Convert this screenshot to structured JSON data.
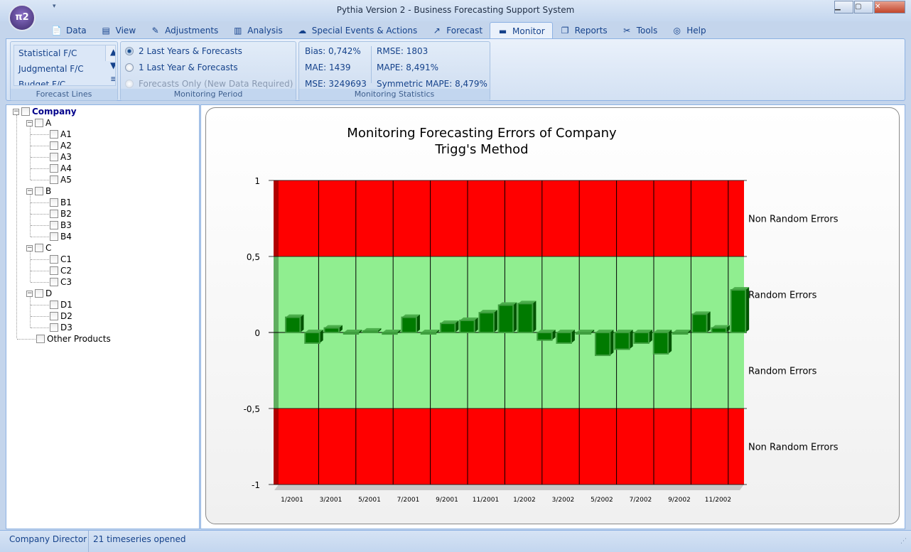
{
  "window": {
    "title": "Pythia Version 2 - Business Forecasting Support System",
    "orb_label": "π2"
  },
  "tabs": [
    {
      "label": "Data",
      "icon": "page-icon",
      "glyph": "📄"
    },
    {
      "label": "View",
      "icon": "view-icon",
      "glyph": "▤"
    },
    {
      "label": "Adjustments",
      "icon": "pencil-icon",
      "glyph": "✎"
    },
    {
      "label": "Analysis",
      "icon": "bar-chart-icon",
      "glyph": "▥"
    },
    {
      "label": "Special Events & Actions",
      "icon": "storm-icon",
      "glyph": "☁"
    },
    {
      "label": "Forecast",
      "icon": "line-chart-icon",
      "glyph": "↗"
    },
    {
      "label": "Monitor",
      "icon": "monitor-icon",
      "glyph": "▬",
      "active": true
    },
    {
      "label": "Reports",
      "icon": "reports-icon",
      "glyph": "❐"
    },
    {
      "label": "Tools",
      "icon": "tools-icon",
      "glyph": "✂"
    },
    {
      "label": "Help",
      "icon": "lifebuoy-icon",
      "glyph": "◎"
    }
  ],
  "ribbon": {
    "forecast_lines": {
      "label": "Forecast Lines",
      "items": [
        "Statistical F/C",
        "Judgmental F/C",
        "Budget F/C"
      ]
    },
    "monitoring_period": {
      "label": "Monitoring Period",
      "options": [
        {
          "label": "2 Last Years & Forecasts",
          "selected": true,
          "enabled": true
        },
        {
          "label": "1 Last Year & Forecasts",
          "selected": false,
          "enabled": true
        },
        {
          "label": "Forecasts Only (New Data Required)",
          "selected": false,
          "enabled": false
        }
      ]
    },
    "monitoring_statistics": {
      "label": "Monitoring Statistics",
      "bias": "Bias: 0,742%",
      "mae": "MAE: 1439",
      "mse": "MSE: 3249693",
      "rmse": "RMSE: 1803",
      "mape": "MAPE: 8,491%",
      "smape": "Symmetric MAPE: 8,479%"
    }
  },
  "tree": {
    "root": "Company",
    "groups": [
      {
        "name": "A",
        "children": [
          "A1",
          "A2",
          "A3",
          "A4",
          "A5"
        ]
      },
      {
        "name": "B",
        "children": [
          "B1",
          "B2",
          "B3",
          "B4"
        ]
      },
      {
        "name": "C",
        "children": [
          "C1",
          "C2",
          "C3"
        ]
      },
      {
        "name": "D",
        "children": [
          "D1",
          "D2",
          "D3"
        ]
      }
    ],
    "other": "Other Products"
  },
  "chart_data": {
    "type": "bar",
    "title": "Monitoring Forecasting Errors of Company",
    "subtitle": "Trigg's Method",
    "ylim": [
      -1,
      1
    ],
    "yticks": [
      "1",
      "0,5",
      "0",
      "-0,5",
      "-1"
    ],
    "ytick_values": [
      1,
      0.5,
      0,
      -0.5,
      -1
    ],
    "xtick_labels": [
      "1/2001",
      "3/2001",
      "5/2001",
      "7/2001",
      "9/2001",
      "11/2001",
      "1/2002",
      "3/2002",
      "5/2002",
      "7/2002",
      "9/2002",
      "11/2002"
    ],
    "categories": [
      "1/2001",
      "2/2001",
      "3/2001",
      "4/2001",
      "5/2001",
      "6/2001",
      "7/2001",
      "8/2001",
      "9/2001",
      "10/2001",
      "11/2001",
      "12/2001",
      "1/2002",
      "2/2002",
      "3/2002",
      "4/2002",
      "5/2002",
      "6/2002",
      "7/2002",
      "8/2002",
      "9/2002",
      "10/2002",
      "11/2002",
      "12/2002"
    ],
    "values": [
      0.1,
      -0.07,
      0.03,
      0.0,
      0.01,
      -0.01,
      0.1,
      0.0,
      0.06,
      0.08,
      0.13,
      0.18,
      0.19,
      -0.05,
      -0.07,
      0.0,
      -0.15,
      -0.11,
      -0.07,
      -0.14,
      0.0,
      0.12,
      0.03,
      0.28
    ],
    "bands": [
      {
        "from": 0.5,
        "to": 1,
        "label": "Non Random Errors",
        "color": "#ff0000"
      },
      {
        "from": 0,
        "to": 0.5,
        "label": "Random Errors",
        "color": "#90ee90"
      },
      {
        "from": -0.5,
        "to": 0,
        "label": "Random Errors",
        "color": "#90ee90"
      },
      {
        "from": -1,
        "to": -0.5,
        "label": "Non Random Errors",
        "color": "#ff0000"
      }
    ],
    "bar_color": "#007a00",
    "grid": true
  },
  "status": {
    "user": "Company Director",
    "info": "21 timeseries opened"
  }
}
